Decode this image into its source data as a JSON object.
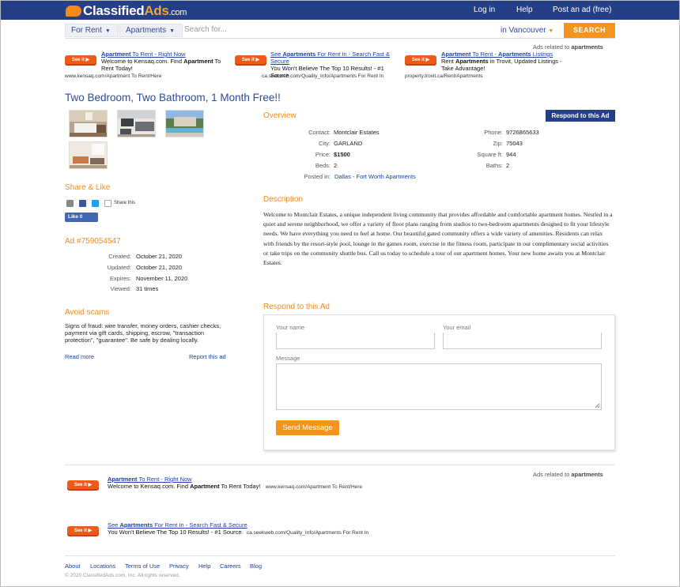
{
  "colors": {
    "brand_navy": "#243f87",
    "brand_orange": "#f6931d",
    "link_blue": "#1a3fa8"
  },
  "header": {
    "logo": {
      "part1": "Classified",
      "part2": "Ads",
      "part3": ".com"
    },
    "nav": {
      "login": "Log in",
      "help": "Help",
      "post": "Post an ad (free)"
    }
  },
  "search": {
    "category": "For Rent",
    "subcategory": "Apartments",
    "placeholder": "Search for...",
    "location": "in Vancouver",
    "button": "SEARCH"
  },
  "top_ads": {
    "related_prefix": "Ads related to",
    "related_term": "apartments",
    "see_it": "See it ▶",
    "items": [
      {
        "title_bold": "Apartment",
        "title_rest": " To Rent - Right Now",
        "desc_a": "Welcome to Kensaq.com. Find ",
        "desc_b": "Apartment",
        "desc_c": " To Rent Today!",
        "url": "www.kensaq.com/Apartment To Rent/Here"
      },
      {
        "title_a": "See ",
        "title_bold": "Apartments",
        "title_rest": " For Rent In - Search Fast & Secure",
        "desc_a": "You Won't Believe The Top 10 Results! - #1 Source",
        "url": "ca.seekweb.com/Quality_Info/Apartments For Rent In"
      },
      {
        "title_bold": "Apartment",
        "title_rest": " To Rent - ",
        "title_bold2": "Apartments",
        "title_rest2": " Listings",
        "desc_a": "Rent ",
        "desc_b": "Apartments",
        "desc_c": " in Trovit, Updated Listings - Take Advantage!",
        "url": "property.trovit.ca/Rent/Apartments"
      }
    ]
  },
  "listing": {
    "title": "Two Bedroom, Two Bathroom, 1 Month Free!!",
    "respond_button": "Respond to this Ad",
    "overview_heading": "Overview",
    "overview": {
      "contact_label": "Contact:",
      "contact": "Montclair Estates",
      "phone_label": "Phone:",
      "phone": "9726865633",
      "city_label": "City:",
      "city": "GARLAND",
      "zip_label": "Zip:",
      "zip": "75043",
      "price_label": "Price:",
      "price": "$1500",
      "sqft_label": "Square ft:",
      "sqft": "944",
      "beds_label": "Beds:",
      "beds": "2",
      "baths_label": "Baths:",
      "baths": "2",
      "posted_label": "Posted in:",
      "posted": "Dallas - Fort Worth Apartments"
    },
    "description_heading": "Description",
    "description": "Welcome to Montclair Estates, a unique independent living community that provides affordable and comfortable apartment homes. Nestled in a quiet and serene neighborhood, we offer a variety of floor plans ranging from studios to two-bedroom apartments designed to fit your lifestyle needs. We have everything you need to feel at home. Our beautiful gated community offers a wide variety of amenities. Residents can relax with friends by the resort-style pool, lounge in the games room, exercise in the fitness room, participate in our complimentary social activities or take trips on the community shuttle bus. Call us today to schedule a tour of our apartment homes. Your new home awaits you at Montclair Estates."
  },
  "share": {
    "heading": "Share & Like",
    "share_this": "Share this",
    "like": "Like 0"
  },
  "ad_info": {
    "heading": "Ad #759054547",
    "created_label": "Created:",
    "created": "October 21, 2020",
    "updated_label": "Updated:",
    "updated": "October 21, 2020",
    "expires_label": "Expires:",
    "expires": "November 11, 2020",
    "viewed_label": "Viewed:",
    "viewed": "31 times"
  },
  "scams": {
    "heading": "Avoid scams",
    "text": "Signs of fraud: wire transfer, money orders, cashier checks, payment via gift cards, shipping, escrow, \"transaction protection\", \"guarantee\". Be safe by dealing locally.",
    "read_more": "Read more",
    "report": "Report this ad"
  },
  "form": {
    "heading": "Respond to this Ad",
    "name_label": "Your name",
    "email_label": "Your email",
    "message_label": "Message",
    "send": "Send Message"
  },
  "bottom_ads": {
    "related_prefix": "Ads related to",
    "related_term": "apartments",
    "see_it": "See it ▶",
    "items": [
      {
        "title_bold": "Apartment",
        "title_rest": " To Rent - Right Now",
        "desc_a": "Welcome to Kensaq.com. Find ",
        "desc_b": "Apartment",
        "desc_c": " To Rent Today!",
        "url": "www.kensaq.com/Apartment To Rent/Here"
      },
      {
        "title_a": "See ",
        "title_bold": "Apartments",
        "title_rest": " For Rent In - Search Fast & Secure",
        "desc_a": "You Won't Believe The Top 10 Results! - #1 Source",
        "url": "ca.seekweb.com/Quality_Info/Apartments For Rent In"
      }
    ]
  },
  "footer": {
    "links": [
      "About",
      "Locations",
      "Terms of Use",
      "Privacy",
      "Help",
      "Careers",
      "Blog"
    ],
    "copyright": "© 2020 ClassifiedAds.com, Inc. All rights reserved."
  }
}
